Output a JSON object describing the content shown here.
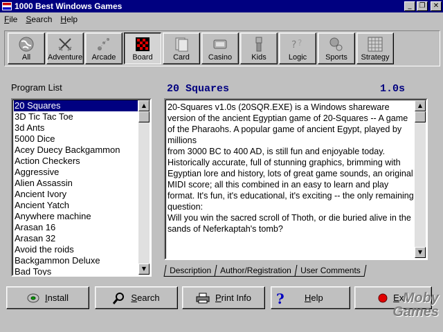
{
  "window": {
    "title": "1000 Best Windows Games",
    "controls": [
      "_",
      "❐",
      "✕"
    ]
  },
  "menu": [
    "File",
    "Search",
    "Help"
  ],
  "categories": [
    {
      "label": "All",
      "icon": "globe-icon"
    },
    {
      "label": "Adventure",
      "icon": "crossed-swords-icon"
    },
    {
      "label": "Arcade",
      "icon": "arcade-dots-icon"
    },
    {
      "label": "Board",
      "icon": "board-checker-icon"
    },
    {
      "label": "Card",
      "icon": "cards-icon"
    },
    {
      "label": "Casino",
      "icon": "casino-chips-icon"
    },
    {
      "label": "Kids",
      "icon": "kids-toy-icon"
    },
    {
      "label": "Logic",
      "icon": "question-marks-icon"
    },
    {
      "label": "Sports",
      "icon": "sports-ball-icon"
    },
    {
      "label": "Strategy",
      "icon": "grid-icon"
    }
  ],
  "selected_category": "Board",
  "program_list": {
    "label": "Program List",
    "items": [
      "20 Squares",
      "3D Tic Tac Toe",
      "3d Ants",
      "5000 Dice",
      "Acey Duecy Backgammon",
      "Action Checkers",
      "Aggressive",
      "Alien Assassin",
      "Ancient Ivory",
      "Ancient Yatch",
      "Anywhere machine",
      "Arasan 16",
      "Arasan 32",
      "Avoid the roids",
      "Backgammon Deluxe",
      "Bad Toys"
    ],
    "selected": "20 Squares",
    "scroll_fraction": 0.0
  },
  "game": {
    "name": "20 Squares",
    "version": "1.0s",
    "description": "20-Squares v1.0s (20SQR.EXE) is a Windows shareware version of the ancient Egyptian game of 20-Squares -- A game of the Pharaohs.  A popular game of ancient Egypt, played by millions\nfrom 3000 BC to 400 AD, is still fun and enjoyable today.  Historically accurate, full of stunning graphics, brimming with Egyptian lore and history, lots of great game sounds, an original MIDI score; all this combined in an easy to learn and play format.  It's fun, it's educational, it's exciting -- the only remaining question:\nWill you win the sacred scroll of Thoth, or die buried alive in the sands of Neferkaptah's tomb?"
  },
  "tabs": [
    "Description",
    "Author/Registration",
    "User Comments"
  ],
  "active_tab": "Description",
  "actions": [
    {
      "label": "Install",
      "icon": "disk-icon"
    },
    {
      "label": "Search",
      "icon": "magnifier-icon"
    },
    {
      "label": "Print Info",
      "icon": "printer-icon"
    },
    {
      "label": "Help",
      "icon": "question-icon"
    },
    {
      "label": "Exit",
      "icon": "red-dot-icon"
    }
  ],
  "watermark": {
    "line1": "Moby",
    "line2": "Games"
  }
}
